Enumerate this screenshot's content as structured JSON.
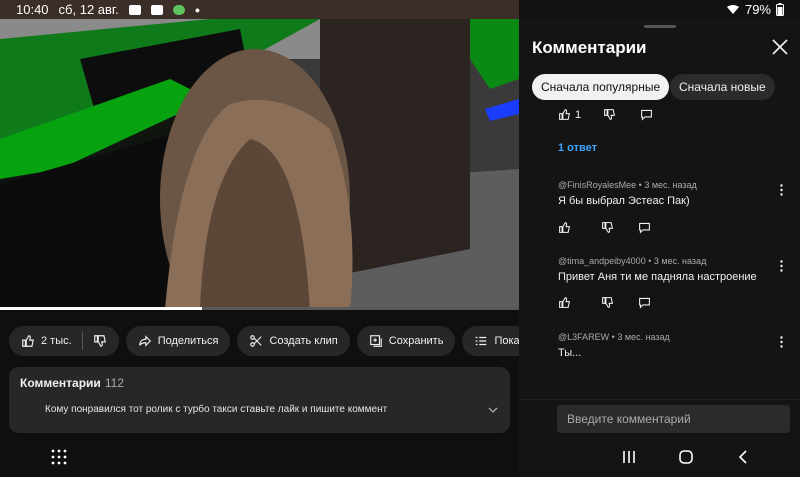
{
  "status_bar": {
    "time": "10:40",
    "date": "сб, 12 авг.",
    "battery": "79%",
    "icons": [
      "youtube-icon",
      "check-icon",
      "android-icon",
      "dot-icon",
      "wifi-icon",
      "battery-icon"
    ]
  },
  "video": {
    "progress_fraction": 0.39
  },
  "actions": {
    "like_count": "2 тыс.",
    "share": "Поделиться",
    "clip": "Создать клип",
    "save": "Сохранить",
    "transcript": "Показать текст видео"
  },
  "comments_card": {
    "title": "Комментарии",
    "count": "112",
    "top_comment": "Кому понравился тот ролик с турбо такси ставьте лайк и пишите коммент"
  },
  "panel": {
    "title": "Комментарии",
    "chip_popular": "Сначала популярные",
    "chip_new": "Сначала новые",
    "first_like_count": "1",
    "replies_link": "1 ответ",
    "comments": [
      {
        "author": "@FinisRoyalesMee",
        "time": "3 мес. назад",
        "text": "Я бы выбрал Эстеас Пак)"
      },
      {
        "author": "@tima_andpeiby4000",
        "time": "3 мес. назад",
        "text": "Привет  Аня ти  ме падняла  настроение"
      },
      {
        "author": "@L3FAREW",
        "time": "3 мес. назад",
        "text": "Ты..."
      }
    ],
    "input_placeholder": "Введите комментарий"
  },
  "colors": {
    "background": "#0f0f0f",
    "panel": "#141414",
    "pill": "#272727",
    "accent_link": "#3ea6ff",
    "status_bar": "#3b2e28"
  }
}
